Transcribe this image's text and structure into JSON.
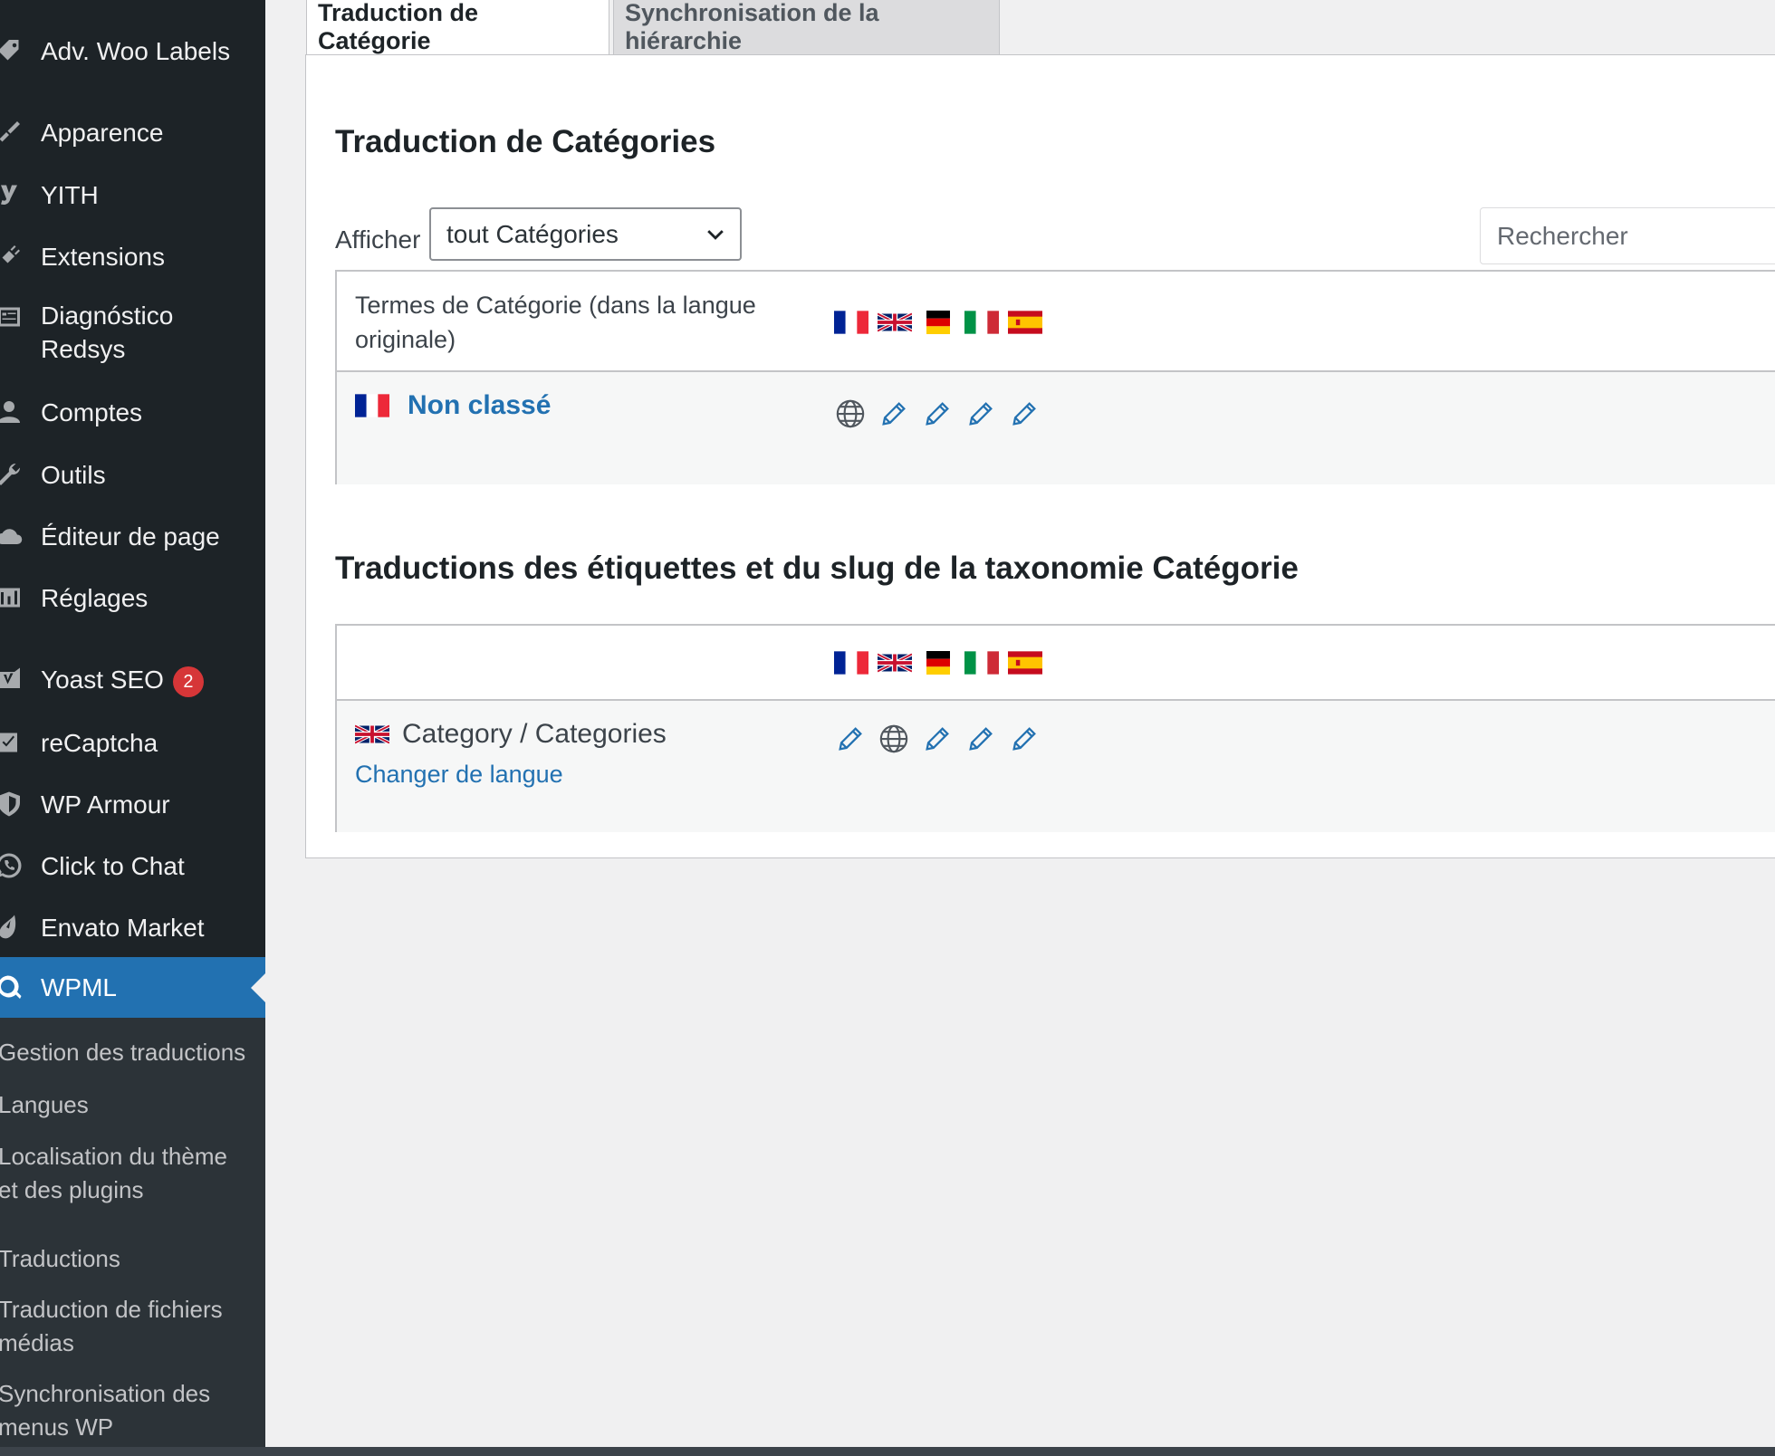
{
  "sidebar": {
    "items": [
      {
        "label": "Adv. Woo Labels",
        "icon": "tag-icon"
      },
      {
        "label": "Apparence",
        "icon": "paintbrush-icon"
      },
      {
        "label": "YITH",
        "icon": "yith-icon"
      },
      {
        "label": "Extensions",
        "icon": "plugin-icon"
      },
      {
        "label": "Diagnóstico",
        "label2": "Redsys",
        "icon": "diagnostic-icon"
      },
      {
        "label": "Comptes",
        "icon": "users-icon"
      },
      {
        "label": "Outils",
        "icon": "wrench-icon"
      },
      {
        "label": "Éditeur de page",
        "icon": "cloud-icon"
      },
      {
        "label": "Réglages",
        "icon": "settings-icon"
      },
      {
        "label": "Yoast SEO",
        "icon": "yoast-icon",
        "badge": "2"
      },
      {
        "label": "reCaptcha",
        "icon": "checkbox-icon"
      },
      {
        "label": "WP Armour",
        "icon": "shield-icon"
      },
      {
        "label": "Click to Chat",
        "icon": "whatsapp-icon"
      },
      {
        "label": "Envato Market",
        "icon": "envato-icon"
      },
      {
        "label": "WPML",
        "icon": "wpml-icon",
        "active": true
      }
    ],
    "submenu": [
      {
        "label": "Gestion des traductions"
      },
      {
        "label": "Langues"
      },
      {
        "label": "Localisation du thème",
        "label2": "et des plugins"
      },
      {
        "label": "Traductions"
      },
      {
        "label": "Traduction de fichiers",
        "label2": "médias"
      },
      {
        "label": "Synchronisation des",
        "label2": "menus WP"
      }
    ]
  },
  "tabs": [
    {
      "label": "Traduction de Catégorie",
      "active": true
    },
    {
      "label": "Synchronisation de la hiérarchie",
      "active": false
    }
  ],
  "section1": {
    "title": "Traduction de Catégories",
    "filter_label": "Afficher",
    "filter_value": "tout Catégories",
    "search_placeholder": "Rechercher",
    "col_header_line1": "Termes de Catégorie (dans la langue",
    "col_header_line2": "originale)",
    "row_term": "Non classé"
  },
  "section2": {
    "title": "Traductions des étiquettes et du slug de la taxonomie Catégorie",
    "row_term": "Category / Categories",
    "change_lang": "Changer de langue"
  },
  "languages": [
    "fr",
    "en",
    "de",
    "it",
    "es"
  ],
  "colors": {
    "accent": "#2271b1",
    "sidebar": "#1d2327",
    "submenu": "#2c3338",
    "badge": "#d63638"
  }
}
